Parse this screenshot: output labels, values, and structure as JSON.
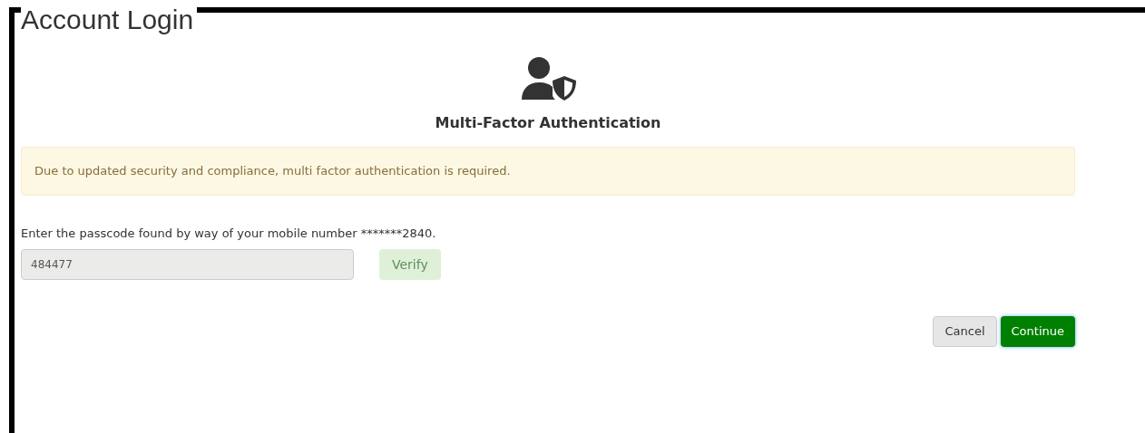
{
  "page_title": "Account Login",
  "heading": "Multi-Factor Authentication",
  "alert": "Due to updated security and compliance, multi factor authentication is required.",
  "instruction": "Enter the passcode found by way of your mobile number *******2840.",
  "passcode": {
    "value": "484477",
    "disabled": true
  },
  "verify_button": {
    "label": "Verify",
    "disabled": true
  },
  "buttons": [
    {
      "label": "Cancel",
      "kind": "secondary"
    },
    {
      "label": "Continue",
      "kind": "primary"
    }
  ]
}
